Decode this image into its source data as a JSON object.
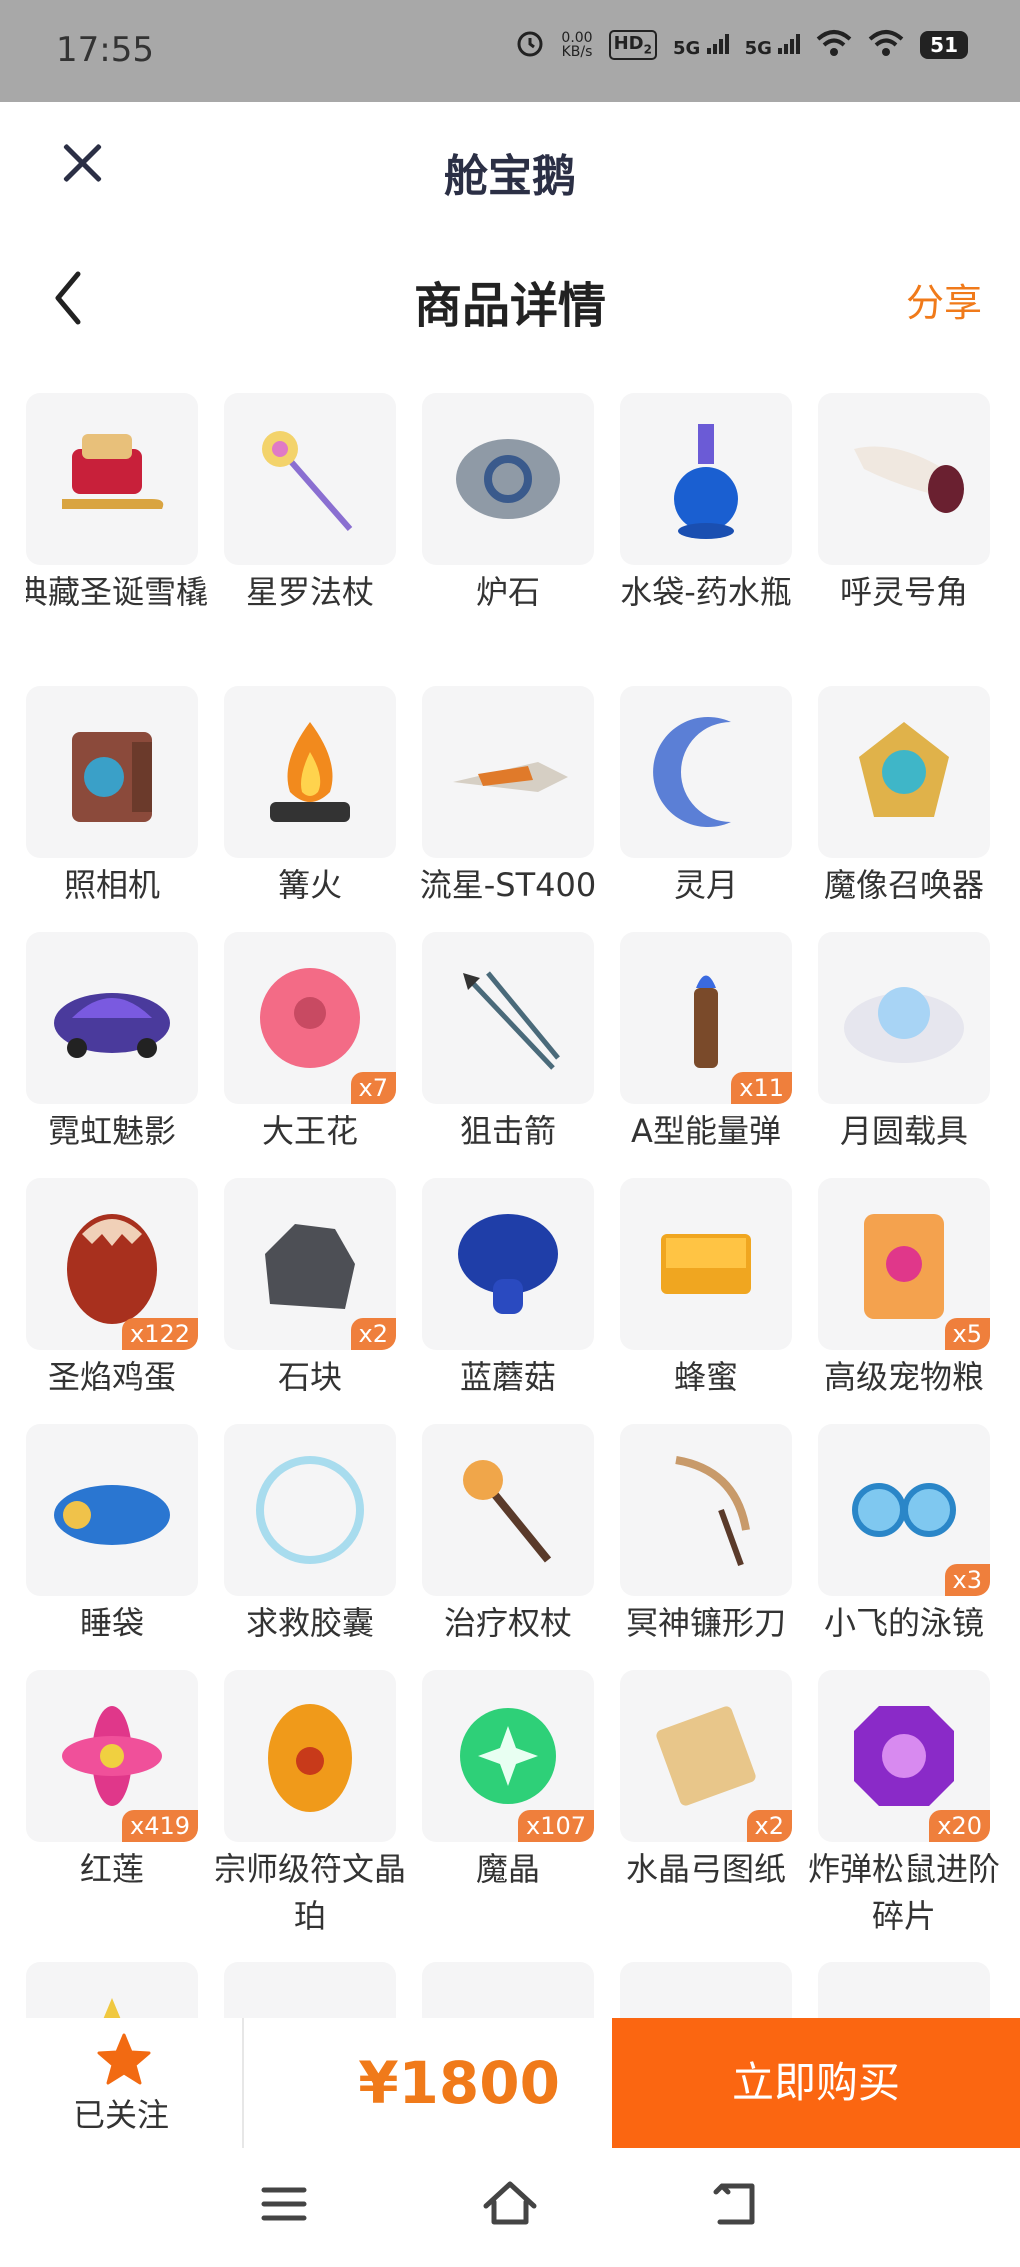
{
  "status": {
    "time": "17:55",
    "net_speed_value": "0.00",
    "net_speed_unit": "KB/s",
    "hd": "HD",
    "hd_sub": "2",
    "sim1": "5G",
    "sim2": "5G",
    "battery": "51"
  },
  "app": {
    "title": "舱宝鹅"
  },
  "header": {
    "title": "商品详情",
    "share_label": "分享"
  },
  "items": [
    {
      "name": "典藏圣诞雪橇",
      "qty": "",
      "icon": "sleigh-icon"
    },
    {
      "name": "星罗法杖",
      "qty": "",
      "icon": "staff-icon"
    },
    {
      "name": "炉石",
      "qty": "",
      "icon": "hearthstone-icon"
    },
    {
      "name": "水袋-药水瓶",
      "qty": "",
      "icon": "potion-icon"
    },
    {
      "name": "呼灵号角",
      "qty": "",
      "icon": "horn-icon"
    },
    {
      "name": "照相机",
      "qty": "",
      "icon": "camera-icon"
    },
    {
      "name": "篝火",
      "qty": "",
      "icon": "campfire-icon"
    },
    {
      "name": "流星-ST400",
      "qty": "",
      "icon": "ship-icon"
    },
    {
      "name": "灵月",
      "qty": "",
      "icon": "moon-icon"
    },
    {
      "name": "魔像召唤器",
      "qty": "",
      "icon": "emblem-icon"
    },
    {
      "name": "霓虹魅影",
      "qty": "",
      "icon": "vehicle-icon"
    },
    {
      "name": "大王花",
      "qty": "x7",
      "icon": "flower-icon"
    },
    {
      "name": "狙击箭",
      "qty": "",
      "icon": "arrows-icon"
    },
    {
      "name": "A型能量弹",
      "qty": "x11",
      "icon": "bullet-icon"
    },
    {
      "name": "月圆载具",
      "qty": "",
      "icon": "cloud-orb-icon"
    },
    {
      "name": "圣焰鸡蛋",
      "qty": "x122",
      "icon": "egg-icon"
    },
    {
      "name": "石块",
      "qty": "x2",
      "icon": "rock-icon"
    },
    {
      "name": "蓝蘑菇",
      "qty": "",
      "icon": "mushroom-icon"
    },
    {
      "name": "蜂蜜",
      "qty": "",
      "icon": "honeycomb-icon"
    },
    {
      "name": "高级宠物粮",
      "qty": "x5",
      "icon": "pet-food-icon"
    },
    {
      "name": "睡袋",
      "qty": "",
      "icon": "sleeping-bag-icon"
    },
    {
      "name": "求救胶囊",
      "qty": "",
      "icon": "bubble-icon"
    },
    {
      "name": "治疗权杖",
      "qty": "",
      "icon": "scepter-icon"
    },
    {
      "name": "冥神镰形刀",
      "qty": "",
      "icon": "scythe-icon"
    },
    {
      "name": "小飞的泳镜",
      "qty": "x3",
      "icon": "goggles-icon"
    },
    {
      "name": "红莲",
      "qty": "x419",
      "icon": "lotus-icon"
    },
    {
      "name": "宗师级符文晶珀",
      "qty": "",
      "icon": "amber-egg-icon"
    },
    {
      "name": "魔晶",
      "qty": "x107",
      "icon": "green-orb-icon"
    },
    {
      "name": "水晶弓图纸",
      "qty": "x2",
      "icon": "scroll-icon"
    },
    {
      "name": "炸弹松鼠进阶碎片",
      "qty": "x20",
      "icon": "purple-gem-icon"
    },
    {
      "name": "",
      "qty": "",
      "icon": "gold-shard-icon"
    },
    {
      "name": "",
      "qty": "",
      "icon": "pink-gem-icon"
    },
    {
      "name": "",
      "qty": "",
      "icon": "item-icon"
    },
    {
      "name": "",
      "qty": "",
      "icon": "item-icon"
    },
    {
      "name": "",
      "qty": "",
      "icon": "item-icon"
    }
  ],
  "footer": {
    "follow_label": "已关注",
    "price": "¥1800",
    "buy_label": "立即购买"
  },
  "colors": {
    "accent": "#f07a1a",
    "buy_button": "#fb6611",
    "badge": "#ef7f3c"
  }
}
